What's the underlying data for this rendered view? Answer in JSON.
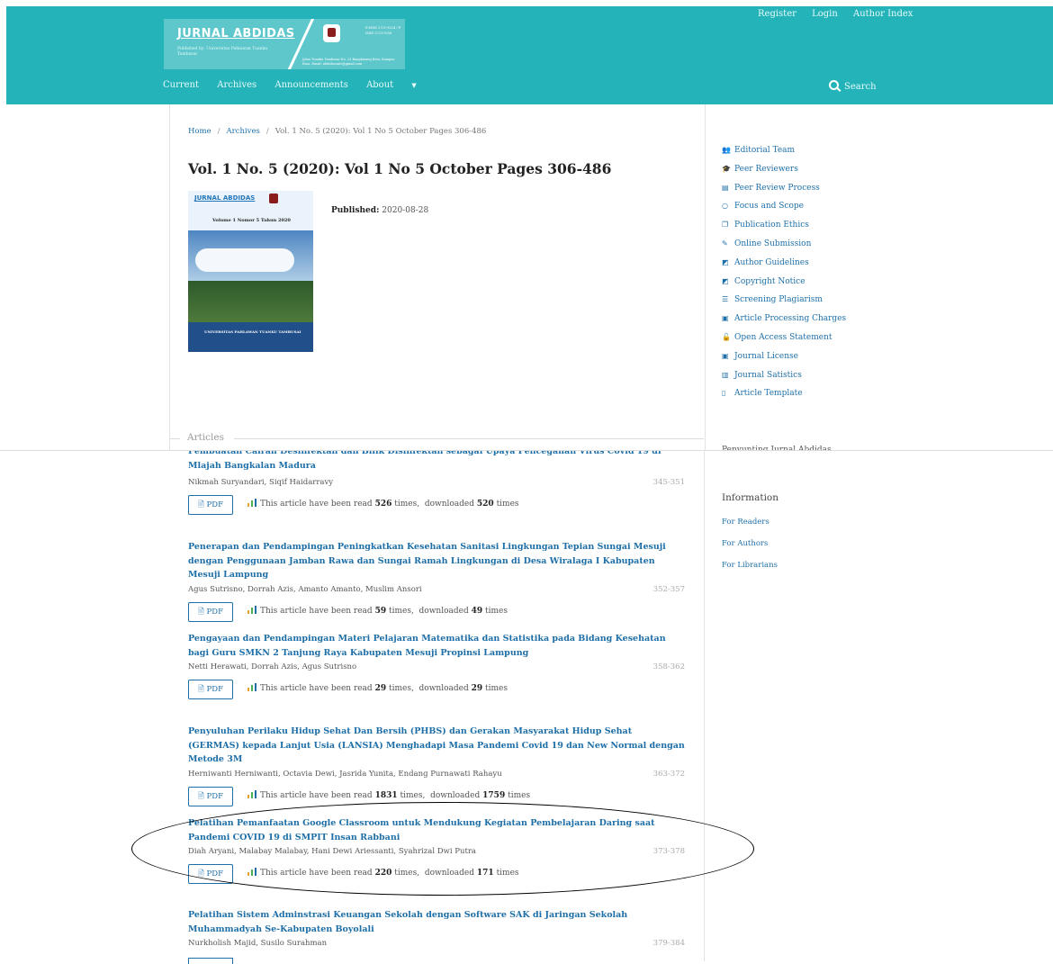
{
  "header": {
    "user_nav": [
      "Register",
      "Login",
      "Author Index"
    ],
    "logo_title": "JURNAL ABDIDAS",
    "logo_publisher": "Published by: Universitas Pahlawan Tuanku Tambusai",
    "logo_issn": "E-ISSN 2721-9224 / P-ISSN 2721-9216",
    "logo_address": "Jalan Tuanku Tambusai No. 23 Bangkinang Kota, Kampar, Riau. Email: abdidasuniv@gmail.com",
    "nav": {
      "current": "Current",
      "archives": "Archives",
      "announcements": "Announcements",
      "about": "About"
    },
    "search_label": "Search"
  },
  "breadcrumb": {
    "home": "Home",
    "archives": "Archives",
    "current": "Vol. 1 No. 5 (2020): Vol 1 No 5 October Pages 306-486"
  },
  "issue": {
    "title": "Vol. 1 No. 5 (2020): Vol 1 No 5 October Pages 306-486",
    "published_label": "Published:",
    "published_date": "2020-08-28",
    "cover_title": "JURNAL ABDIDAS",
    "cover_volume": "Volume 1 Nomor 5 Tahun 2020",
    "cover_footer": "UNIVERSITAS PAHLAWAN TUANKU TAMBUSAI"
  },
  "articles_label": "Articles",
  "articles": [
    {
      "title": "Pembuatan Cairan Desinfektan dan Bilik Disinfektan sebagai Upaya Pencegahan Virus Covid 19 di Mlajah Bangkalan Madura",
      "authors": "Nikmah Suryandari, Siqif Haidarravy",
      "pages": "345-351",
      "read": "526",
      "downloaded": "520"
    },
    {
      "title": "Penerapan dan Pendampingan Peningkatkan Kesehatan Sanitasi Lingkungan Tepian Sungai Mesuji dengan Penggunaan Jamban Rawa dan Sungai Ramah Lingkungan di Desa Wiralaga I Kabupaten Mesuji Lampung",
      "authors": "Agus Sutrisno, Dorrah Azis, Amanto Amanto, Muslim Ansori",
      "pages": "352-357",
      "read": "59",
      "downloaded": "49"
    },
    {
      "title": "Pengayaan dan Pendampingan Materi Pelajaran Matematika dan Statistika pada Bidang Kesehatan bagi Guru SMKN 2 Tanjung Raya Kabupaten Mesuji Propinsi Lampung",
      "authors": "Netti Herawati, Dorrah Azis, Agus Sutrisno",
      "pages": "358-362",
      "read": "29",
      "downloaded": "29"
    },
    {
      "title": "Penyuluhan Perilaku Hidup Sehat Dan Bersih (PHBS) dan Gerakan Masyarakat Hidup Sehat (GERMAS) kepada Lanjut Usia (LANSIA) Menghadapi Masa Pandemi Covid 19 dan New Normal dengan Metode 3M",
      "authors": "Herniwanti Herniwanti, Octavia Dewi, Jasrida Yunita, Endang Purnawati Rahayu",
      "pages": "363-372",
      "read": "1831",
      "downloaded": "1759"
    },
    {
      "title": "Pelatihan Pemanfaatan Google Classroom untuk Mendukung Kegiatan Pembelajaran Daring saat Pandemi COVID 19 di SMPIT Insan Rabbani",
      "authors": "Diah Aryani, Malabay Malabay, Hani Dewi Ariessanti, Syahrizal Dwi Putra",
      "pages": "373-378",
      "read": "220",
      "downloaded": "171"
    },
    {
      "title": "Pelatihan Sistem Adminstrasi Keuangan Sekolah dengan Software SAK di Jaringan Sekolah Muhammadyah Se-Kabupaten Boyolali",
      "authors": "Nurkholish Majid, Susilo Surahman",
      "pages": "379-384"
    }
  ],
  "labels": {
    "pdf": "PDF",
    "read_prefix": "This article have been read",
    "times": "times,",
    "downloaded": "downloaded",
    "times_end": "times"
  },
  "sidebar": {
    "links": [
      {
        "icon": "users-icon",
        "glyph": "👥",
        "label": "Editorial Team"
      },
      {
        "icon": "graduation-cap-icon",
        "glyph": "🎓",
        "label": "Peer Reviewers"
      },
      {
        "icon": "newspaper-icon",
        "glyph": "▤",
        "label": "Peer Review Process"
      },
      {
        "icon": "circle-icon",
        "glyph": "○",
        "label": "Focus and Scope"
      },
      {
        "icon": "copy-icon",
        "glyph": "❐",
        "label": "Publication Ethics"
      },
      {
        "icon": "edit-icon",
        "glyph": "✎",
        "label": "Online Submission"
      },
      {
        "icon": "pencil-square-icon",
        "glyph": "◩",
        "label": "Author Guidelines"
      },
      {
        "icon": "pencil-square-icon",
        "glyph": "◩",
        "label": "Copyright Notice"
      },
      {
        "icon": "list-icon",
        "glyph": "☰",
        "label": "Screening Plagiarism"
      },
      {
        "icon": "money-icon",
        "glyph": "▣",
        "label": "Article Processing Charges"
      },
      {
        "icon": "unlock-icon",
        "glyph": "🔓",
        "label": "Open Access Statement"
      },
      {
        "icon": "id-card-icon",
        "glyph": "▣",
        "label": "Journal License"
      },
      {
        "icon": "bar-chart-icon",
        "glyph": "▥",
        "label": "Journal Satistics"
      },
      {
        "icon": "file-icon",
        "glyph": "▯",
        "label": "Article Template"
      }
    ],
    "cut_label": "Penyunting Jurnal Abdidas",
    "information_title": "Information",
    "info_links": [
      "For Readers",
      "For Authors",
      "For Librarians"
    ]
  },
  "colors": {
    "header_bg": "#24b3b8",
    "link": "#1e6fa8",
    "highlight_ellipse": "#000000"
  }
}
